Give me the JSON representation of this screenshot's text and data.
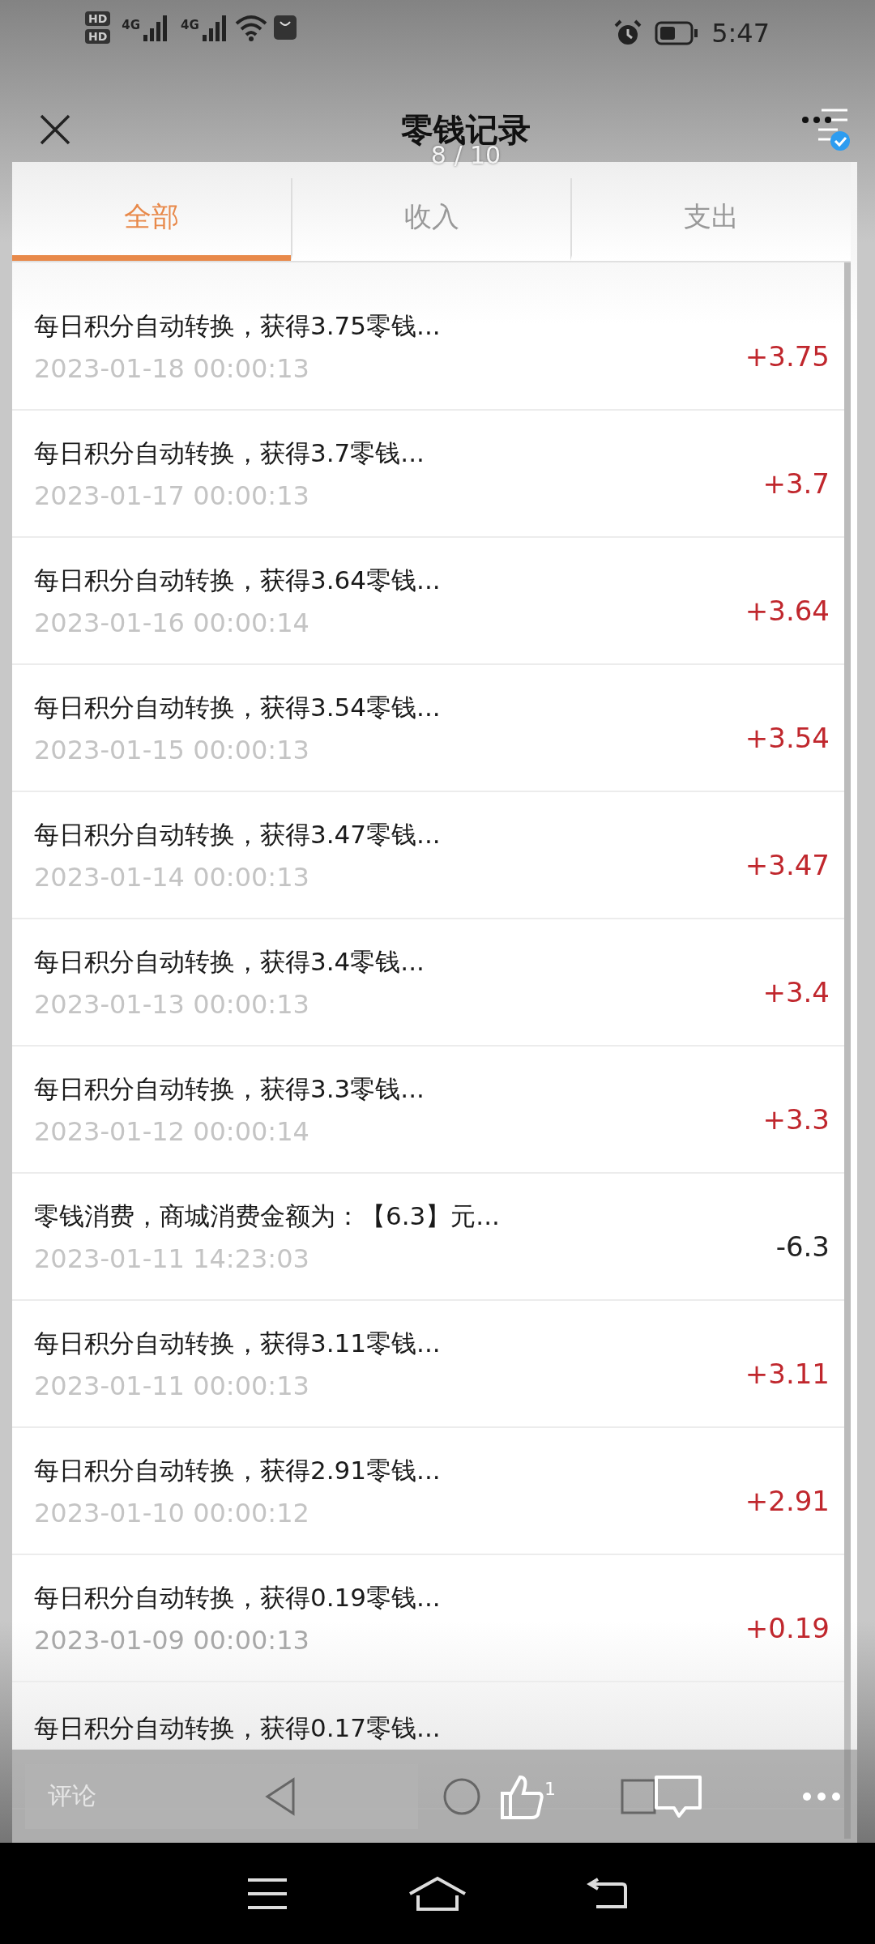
{
  "status_bar": {
    "sim_labels": [
      "HD",
      "HD"
    ],
    "network_labels": [
      "4G",
      "4G"
    ],
    "time": "5:47"
  },
  "header": {
    "title": "零钱记录",
    "page_counter": "8 / 10"
  },
  "tabs": [
    {
      "label": "全部",
      "selected": true
    },
    {
      "label": "收入",
      "selected": false
    },
    {
      "label": "支出",
      "selected": false
    }
  ],
  "records": [
    {
      "title": "每日积分自动转换，获得3.75零钱...",
      "time": "2023-01-18 00:00:13",
      "amount": "+3.75",
      "kind": "income"
    },
    {
      "title": "每日积分自动转换，获得3.7零钱...",
      "time": "2023-01-17 00:00:13",
      "amount": "+3.7",
      "kind": "income"
    },
    {
      "title": "每日积分自动转换，获得3.64零钱...",
      "time": "2023-01-16 00:00:14",
      "amount": "+3.64",
      "kind": "income"
    },
    {
      "title": "每日积分自动转换，获得3.54零钱...",
      "time": "2023-01-15 00:00:13",
      "amount": "+3.54",
      "kind": "income"
    },
    {
      "title": "每日积分自动转换，获得3.47零钱...",
      "time": "2023-01-14 00:00:13",
      "amount": "+3.47",
      "kind": "income"
    },
    {
      "title": "每日积分自动转换，获得3.4零钱...",
      "time": "2023-01-13 00:00:13",
      "amount": "+3.4",
      "kind": "income"
    },
    {
      "title": "每日积分自动转换，获得3.3零钱...",
      "time": "2023-01-12 00:00:14",
      "amount": "+3.3",
      "kind": "income"
    },
    {
      "title": "零钱消费，商城消费金额为：【6.3】元...",
      "time": "2023-01-11 14:23:03",
      "amount": "-6.3",
      "kind": "expense"
    },
    {
      "title": "每日积分自动转换，获得3.11零钱...",
      "time": "2023-01-11 00:00:13",
      "amount": "+3.11",
      "kind": "income"
    },
    {
      "title": "每日积分自动转换，获得2.91零钱...",
      "time": "2023-01-10 00:00:12",
      "amount": "+2.91",
      "kind": "income"
    },
    {
      "title": "每日积分自动转换，获得0.19零钱...",
      "time": "2023-01-09 00:00:13",
      "amount": "+0.19",
      "kind": "income"
    },
    {
      "title": "每日积分自动转换，获得0.17零钱..."
    }
  ],
  "bottom_bar": {
    "comment_placeholder": "评论",
    "like_count": "1"
  }
}
